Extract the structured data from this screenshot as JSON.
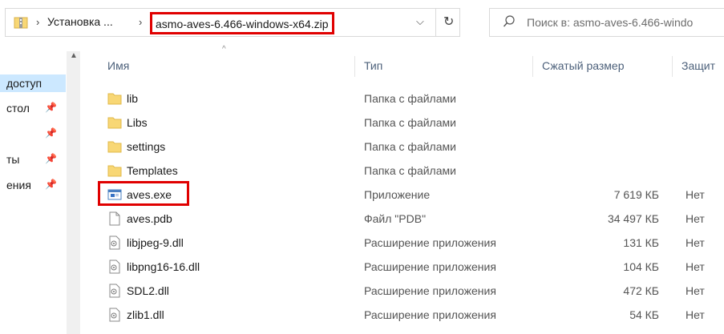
{
  "address": {
    "parent_crumb": "Установка ...",
    "current_crumb": "asmo-aves-6.466-windows-x64.zip",
    "dropdown_icon": "chevron-down-icon",
    "refresh_icon": "refresh-icon"
  },
  "search": {
    "placeholder": "Поиск в: asmo-aves-6.466-windo"
  },
  "nav": {
    "items": [
      {
        "label": "доступ",
        "pinned": false,
        "selected": true
      },
      {
        "label": "стол",
        "pinned": true,
        "selected": false
      },
      {
        "label": "",
        "pinned": true,
        "selected": false
      },
      {
        "label": "ты",
        "pinned": true,
        "selected": false
      },
      {
        "label": "ения",
        "pinned": true,
        "selected": false
      }
    ]
  },
  "columns": {
    "name": "Имя",
    "type": "Тип",
    "size": "Сжатый размер",
    "protected": "Защит"
  },
  "files": [
    {
      "name": "lib",
      "type": "Папка с файлами",
      "size": "",
      "protected": "",
      "icon": "folder-icon"
    },
    {
      "name": "Libs",
      "type": "Папка с файлами",
      "size": "",
      "protected": "",
      "icon": "folder-icon"
    },
    {
      "name": "settings",
      "type": "Папка с файлами",
      "size": "",
      "protected": "",
      "icon": "folder-icon"
    },
    {
      "name": "Templates",
      "type": "Папка с файлами",
      "size": "",
      "protected": "",
      "icon": "folder-icon"
    },
    {
      "name": "aves.exe",
      "type": "Приложение",
      "size": "7 619 КБ",
      "protected": "Нет",
      "icon": "application-icon"
    },
    {
      "name": "aves.pdb",
      "type": "Файл \"PDB\"",
      "size": "34 497 КБ",
      "protected": "Нет",
      "icon": "file-icon"
    },
    {
      "name": "libjpeg-9.dll",
      "type": "Расширение приложения",
      "size": "131 КБ",
      "protected": "Нет",
      "icon": "dll-icon"
    },
    {
      "name": "libpng16-16.dll",
      "type": "Расширение приложения",
      "size": "104 КБ",
      "protected": "Нет",
      "icon": "dll-icon"
    },
    {
      "name": "SDL2.dll",
      "type": "Расширение приложения",
      "size": "472 КБ",
      "protected": "Нет",
      "icon": "dll-icon"
    },
    {
      "name": "zlib1.dll",
      "type": "Расширение приложения",
      "size": "54 КБ",
      "protected": "Нет",
      "icon": "dll-icon"
    }
  ],
  "colors": {
    "highlight": "#e00000",
    "folder": "#f8d775",
    "selection": "#cce8ff"
  }
}
